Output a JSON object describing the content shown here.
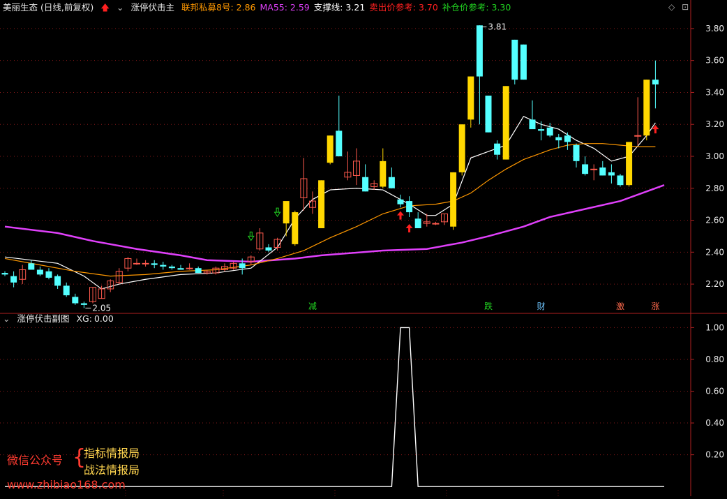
{
  "header": {
    "stock": "美丽生态 (日线,前复权)",
    "indicator_main": "涨停伏击主",
    "legend": [
      {
        "label": "联邦私募8号:",
        "value": "2.86",
        "color": "#ff9800"
      },
      {
        "label": "MA55:",
        "value": "2.59",
        "color": "#e040fb"
      },
      {
        "label": "支撑线:",
        "value": "3.21",
        "color": "#ffffff"
      },
      {
        "label": "卖出价参考:",
        "value": "3.70",
        "color": "#ff2020"
      },
      {
        "label": "补仓价参考:",
        "value": "3.30",
        "color": "#21d421"
      }
    ]
  },
  "sub_header": {
    "indicator_sub": "涨停伏击副图",
    "xg_label": "XG:",
    "xg_value": "0.00"
  },
  "watermark": {
    "left_text": "微信公众号",
    "brace": "{",
    "line1": "指标情报局",
    "line2": "战法情报局",
    "url": "www.zhibiao168.com"
  },
  "chart_data": [
    {
      "type": "candlestick",
      "title": "美丽生态 (日线,前复权)",
      "y_ticks": [
        "3.80",
        "3.60",
        "3.40",
        "3.20",
        "3.00",
        "2.80",
        "2.60",
        "2.40",
        "2.20"
      ],
      "ylim": [
        2.03,
        3.9
      ],
      "candles": [
        [
          2.27,
          2.28,
          2.25,
          2.26
        ],
        [
          2.25,
          2.28,
          2.18,
          2.21
        ],
        [
          2.23,
          2.32,
          2.2,
          2.29
        ],
        [
          2.33,
          2.35,
          2.29,
          2.29
        ],
        [
          2.29,
          2.31,
          2.25,
          2.26
        ],
        [
          2.28,
          2.3,
          2.23,
          2.24
        ],
        [
          2.25,
          2.26,
          2.17,
          2.19
        ],
        [
          2.19,
          2.21,
          2.12,
          2.13
        ],
        [
          2.12,
          2.14,
          2.07,
          2.08
        ],
        [
          2.08,
          2.09,
          2.05,
          2.07
        ],
        [
          2.09,
          2.18,
          2.08,
          2.18
        ],
        [
          2.11,
          2.19,
          2.11,
          2.17
        ],
        [
          2.17,
          2.23,
          2.15,
          2.22
        ],
        [
          2.21,
          2.3,
          2.2,
          2.28
        ],
        [
          2.3,
          2.37,
          2.28,
          2.36
        ],
        [
          2.33,
          2.36,
          2.32,
          2.33
        ],
        [
          2.33,
          2.35,
          2.31,
          2.33
        ],
        [
          2.33,
          2.35,
          2.3,
          2.32
        ],
        [
          2.32,
          2.34,
          2.29,
          2.31
        ],
        [
          2.31,
          2.32,
          2.29,
          2.3
        ],
        [
          2.3,
          2.32,
          2.29,
          2.29
        ],
        [
          2.3,
          2.33,
          2.29,
          2.3
        ],
        [
          2.3,
          2.31,
          2.27,
          2.27
        ],
        [
          2.27,
          2.29,
          2.26,
          2.28
        ],
        [
          2.27,
          2.31,
          2.26,
          2.3
        ],
        [
          2.29,
          2.33,
          2.28,
          2.31
        ],
        [
          2.3,
          2.34,
          2.29,
          2.33
        ],
        [
          2.33,
          2.36,
          2.26,
          2.3
        ],
        [
          2.34,
          2.38,
          2.32,
          2.37
        ],
        [
          2.42,
          2.55,
          2.41,
          2.52
        ],
        [
          2.43,
          2.45,
          2.4,
          2.41
        ],
        [
          2.43,
          2.49,
          2.41,
          2.48
        ],
        [
          2.58,
          2.68,
          2.5,
          2.72
        ],
        [
          2.45,
          2.66,
          2.44,
          2.65
        ],
        [
          2.74,
          2.99,
          2.66,
          2.86
        ],
        [
          2.68,
          2.78,
          2.64,
          2.72
        ],
        [
          2.55,
          2.85,
          2.55,
          2.85
        ],
        [
          2.96,
          3.13,
          2.95,
          3.13
        ],
        [
          3.16,
          3.38,
          3.0,
          3.0
        ],
        [
          2.87,
          3.03,
          2.85,
          2.9
        ],
        [
          2.88,
          3.05,
          2.82,
          2.97
        ],
        [
          2.87,
          2.95,
          2.78,
          2.78
        ],
        [
          2.81,
          2.85,
          2.79,
          2.83
        ],
        [
          2.81,
          3.05,
          2.8,
          2.97
        ],
        [
          2.87,
          2.93,
          2.8,
          2.8
        ],
        [
          2.73,
          2.76,
          2.68,
          2.7
        ],
        [
          2.72,
          2.75,
          2.62,
          2.65
        ],
        [
          2.61,
          2.65,
          2.55,
          2.55
        ],
        [
          2.58,
          2.64,
          2.56,
          2.59
        ],
        [
          2.58,
          2.59,
          2.57,
          2.58
        ],
        [
          2.59,
          2.64,
          2.57,
          2.64
        ],
        [
          2.56,
          2.9,
          2.54,
          2.9
        ],
        [
          2.9,
          3.2,
          2.88,
          3.2
        ],
        [
          3.23,
          3.5,
          3.18,
          3.5
        ],
        [
          3.82,
          3.82,
          3.2,
          3.5
        ],
        [
          3.38,
          3.3,
          3.15,
          3.15
        ],
        [
          3.08,
          3.1,
          2.98,
          3.01
        ],
        [
          2.98,
          3.44,
          2.98,
          3.44
        ],
        [
          3.73,
          3.73,
          3.45,
          3.48
        ],
        [
          3.7,
          3.7,
          3.48,
          3.48
        ],
        [
          3.23,
          3.35,
          3.2,
          3.17
        ],
        [
          3.17,
          3.22,
          3.1,
          3.16
        ],
        [
          3.18,
          3.21,
          3.12,
          3.13
        ],
        [
          3.12,
          3.14,
          3.05,
          3.1
        ],
        [
          3.13,
          3.15,
          3.04,
          3.09
        ],
        [
          3.07,
          3.08,
          2.93,
          2.97
        ],
        [
          2.95,
          3.0,
          2.88,
          2.89
        ],
        [
          2.92,
          2.95,
          2.85,
          2.92
        ],
        [
          2.93,
          2.97,
          2.88,
          2.88
        ],
        [
          2.9,
          2.95,
          2.83,
          2.88
        ],
        [
          2.88,
          2.89,
          2.81,
          2.82
        ],
        [
          2.82,
          3.09,
          2.81,
          3.09
        ],
        [
          3.13,
          3.37,
          3.07,
          3.13
        ],
        [
          3.13,
          3.48,
          3.1,
          3.48
        ],
        [
          3.48,
          3.6,
          3.3,
          3.45
        ]
      ],
      "series": [
        {
          "name": "MA55",
          "color": "#e040fb",
          "values": [
            [
              0,
              2.56
            ],
            [
              6,
              2.52
            ],
            [
              10,
              2.47
            ],
            [
              15,
              2.42
            ],
            [
              20,
              2.38
            ],
            [
              23,
              2.35
            ],
            [
              28,
              2.34
            ],
            [
              33,
              2.36
            ],
            [
              36,
              2.38
            ],
            [
              43,
              2.41
            ],
            [
              48,
              2.42
            ],
            [
              50,
              2.44
            ],
            [
              52,
              2.46
            ],
            [
              55,
              2.5
            ],
            [
              57,
              2.53
            ],
            [
              59,
              2.56
            ],
            [
              62,
              2.62
            ],
            [
              66,
              2.67
            ],
            [
              70,
              2.72
            ],
            [
              75,
              2.82
            ]
          ]
        },
        {
          "name": "支撑线",
          "color": "#ffffff",
          "values": [
            [
              0,
              2.37
            ],
            [
              6,
              2.33
            ],
            [
              9,
              2.25
            ],
            [
              11,
              2.17
            ],
            [
              13,
              2.2
            ],
            [
              16,
              2.23
            ],
            [
              20,
              2.26
            ],
            [
              24,
              2.27
            ],
            [
              28,
              2.3
            ],
            [
              31,
              2.43
            ],
            [
              33,
              2.61
            ],
            [
              35,
              2.73
            ],
            [
              37,
              2.79
            ],
            [
              40,
              2.8
            ],
            [
              43,
              2.79
            ],
            [
              46,
              2.7
            ],
            [
              48,
              2.63
            ],
            [
              49,
              2.63
            ],
            [
              51,
              2.7
            ],
            [
              53,
              2.99
            ],
            [
              55,
              3.03
            ],
            [
              57,
              3.07
            ],
            [
              59,
              3.25
            ],
            [
              61,
              3.2
            ],
            [
              63,
              3.17
            ],
            [
              65,
              3.1
            ],
            [
              67,
              3.05
            ],
            [
              69,
              2.97
            ],
            [
              71,
              3.0
            ],
            [
              73,
              3.13
            ],
            [
              74,
              3.21
            ]
          ]
        },
        {
          "name": "联邦私募8号",
          "color": "#ff9800",
          "values": [
            [
              0,
              2.36
            ],
            [
              4,
              2.32
            ],
            [
              8,
              2.28
            ],
            [
              12,
              2.25
            ],
            [
              16,
              2.26
            ],
            [
              20,
              2.28
            ],
            [
              24,
              2.29
            ],
            [
              28,
              2.32
            ],
            [
              31,
              2.36
            ],
            [
              34,
              2.41
            ],
            [
              37,
              2.49
            ],
            [
              40,
              2.56
            ],
            [
              43,
              2.64
            ],
            [
              46,
              2.69
            ],
            [
              49,
              2.7
            ],
            [
              51,
              2.72
            ],
            [
              53,
              2.77
            ],
            [
              55,
              2.85
            ],
            [
              57,
              2.92
            ],
            [
              59,
              2.98
            ],
            [
              62,
              3.04
            ],
            [
              64,
              3.07
            ],
            [
              66,
              3.08
            ],
            [
              68,
              3.08
            ],
            [
              70,
              3.07
            ],
            [
              72,
              3.06
            ],
            [
              74,
              3.06
            ]
          ]
        }
      ],
      "annotations": [
        {
          "text": "2.05",
          "x": 9,
          "y": 2.05
        },
        {
          "text": "3.81",
          "x": 54,
          "y": 3.81
        },
        {
          "text": "减",
          "x": 35,
          "color": "#21d421"
        },
        {
          "text": "跌",
          "x": 55,
          "color": "#21d421"
        },
        {
          "text": "财",
          "x": 61,
          "color": "#6ec6ff"
        },
        {
          "text": "激",
          "x": 70,
          "color": "#ff6a4d"
        },
        {
          "text": "涨",
          "x": 74,
          "color": "#ff6a4d"
        }
      ],
      "buy_arrows": [
        {
          "x": 31,
          "y": 2.65,
          "color": "#21d421"
        },
        {
          "x": 28,
          "y": 2.5,
          "color": "#21d421"
        }
      ],
      "red_arrows": [
        {
          "x": 45,
          "y": 2.63,
          "color": "#ff2020"
        },
        {
          "x": 46,
          "y": 2.55,
          "color": "#ff2020"
        },
        {
          "x": 74,
          "y": 3.17,
          "color": "#ff2020"
        }
      ]
    },
    {
      "type": "line",
      "title": "涨停伏击副图",
      "y_ticks": [
        "1.00",
        "0.80",
        "0.60",
        "0.40",
        "0.20"
      ],
      "ylim": [
        -0.03,
        1.05
      ],
      "series": [
        {
          "name": "XG",
          "color": "#ffffff",
          "values": [
            [
              0,
              0
            ],
            [
              44,
              0
            ],
            [
              45,
              1
            ],
            [
              46,
              1
            ],
            [
              47,
              0
            ],
            [
              75,
              0
            ]
          ]
        }
      ]
    }
  ]
}
